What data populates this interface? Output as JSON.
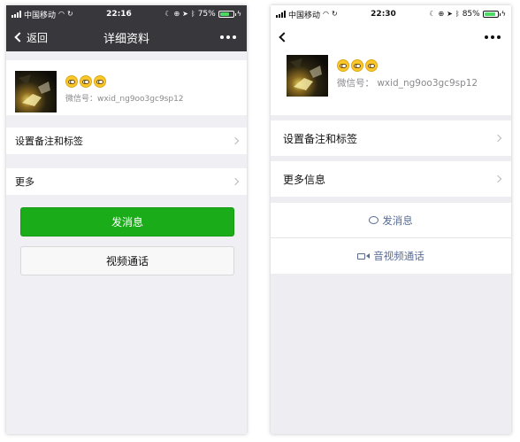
{
  "left_screen": {
    "status_bar": {
      "carrier": "中国移动",
      "time": "22:16",
      "battery": "75%",
      "battery_level": 0.75
    },
    "nav": {
      "back_label": "返回",
      "title": "详细资料"
    },
    "profile": {
      "wechat_id": "微信号：wxid_ng9oo3gc9sp12",
      "emoji_count": 3
    },
    "cells": {
      "remark": "设置备注和标签",
      "more": "更多"
    },
    "buttons": {
      "send": "发消息",
      "video": "视频通话"
    },
    "colors": {
      "nav_bg": "#38373c",
      "primary_button": "#1aad19"
    }
  },
  "right_screen": {
    "status_bar": {
      "carrier": "中国移动",
      "time": "22:30",
      "battery": "85%",
      "battery_level": 0.85
    },
    "profile": {
      "wechat_id": "微信号：  wxid_ng9oo3gc9sp12",
      "emoji_count": 3
    },
    "cells": {
      "remark": "设置备注和标签",
      "more": "更多信息"
    },
    "actions": {
      "send": "发消息",
      "av_call": "音视频通话"
    },
    "colors": {
      "link": "#576b95"
    }
  }
}
